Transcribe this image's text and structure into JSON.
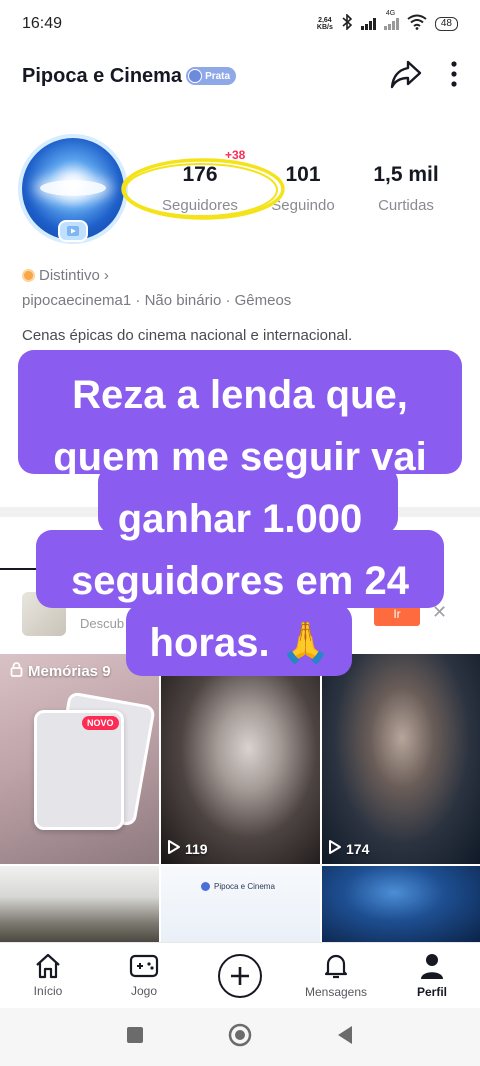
{
  "status_bar": {
    "time": "16:49",
    "net_speed_value": "2,64",
    "net_speed_unit": "KB/s",
    "battery": "48",
    "signal_label": "4G"
  },
  "header": {
    "title": "Pipoca e Cinema",
    "tier_badge": "Prata",
    "share_icon": "share-arrow-icon",
    "more_icon": "more-vertical-icon"
  },
  "profile": {
    "stats": [
      {
        "value": "176",
        "label": "Seguidores"
      },
      {
        "value": "101",
        "label": "Seguindo"
      },
      {
        "value": "1,5 mil",
        "label": "Curtidas"
      }
    ],
    "followers_delta": "+38",
    "distinctive_label": "Distintivo",
    "meta": "pipocaecinema1 · Não binário · Gêmeos",
    "bio": "Cenas épicas do cinema nacional e internacional."
  },
  "overlay_caption": {
    "lines": [
      "Reza a lenda que,",
      "quem me seguir vai",
      "ganhar 1.000",
      "seguidores em 24",
      "horas. 🙏"
    ]
  },
  "promo": {
    "text": "Descub",
    "button": "Ir"
  },
  "grid": {
    "memories_label": "Memórias 9",
    "new_badge": "NOVO",
    "videos": [
      {
        "plays": "119"
      },
      {
        "plays": "174"
      }
    ],
    "brand_tile_text": "Pipoca e Cinema"
  },
  "bottom_nav": {
    "items": [
      {
        "label": "Início",
        "icon": "home-icon"
      },
      {
        "label": "Jogo",
        "icon": "gamepad-icon"
      },
      {
        "label": "",
        "icon": "plus-icon"
      },
      {
        "label": "Mensagens",
        "icon": "bell-icon"
      },
      {
        "label": "Perfil",
        "icon": "person-icon"
      }
    ]
  },
  "colors": {
    "accent": "#fe2c55",
    "caption_bg": "#8a5cf0",
    "highlight_ring": "#f4e318",
    "promo_button": "#fe6b3e"
  }
}
